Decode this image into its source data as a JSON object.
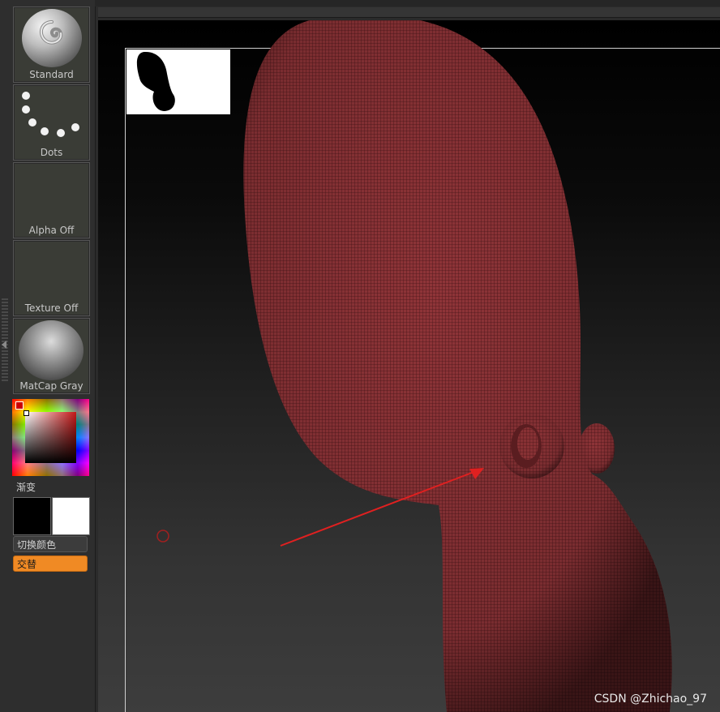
{
  "left_shelf": {
    "brush": {
      "label": "Standard",
      "icon": "standard-brush-icon"
    },
    "stroke": {
      "label": "Dots",
      "icon": "dots-stroke-icon"
    },
    "alpha": {
      "label": "Alpha Off"
    },
    "texture": {
      "label": "Texture Off"
    },
    "material": {
      "label": "MatCap Gray",
      "icon": "matcap-sphere-icon"
    },
    "color": {
      "primary": "#000000",
      "secondary": "#ffffff",
      "picker_hue": "#c41818"
    },
    "gradient_label": "渐变",
    "switch_color_label": "切换颜色",
    "alternate_label": "交替",
    "accent": "#f08a24"
  },
  "canvas": {
    "mesh_color": "#8a3236",
    "watermark": "CSDN @Zhichao_97",
    "annotation_arrow_color": "#e02020"
  }
}
